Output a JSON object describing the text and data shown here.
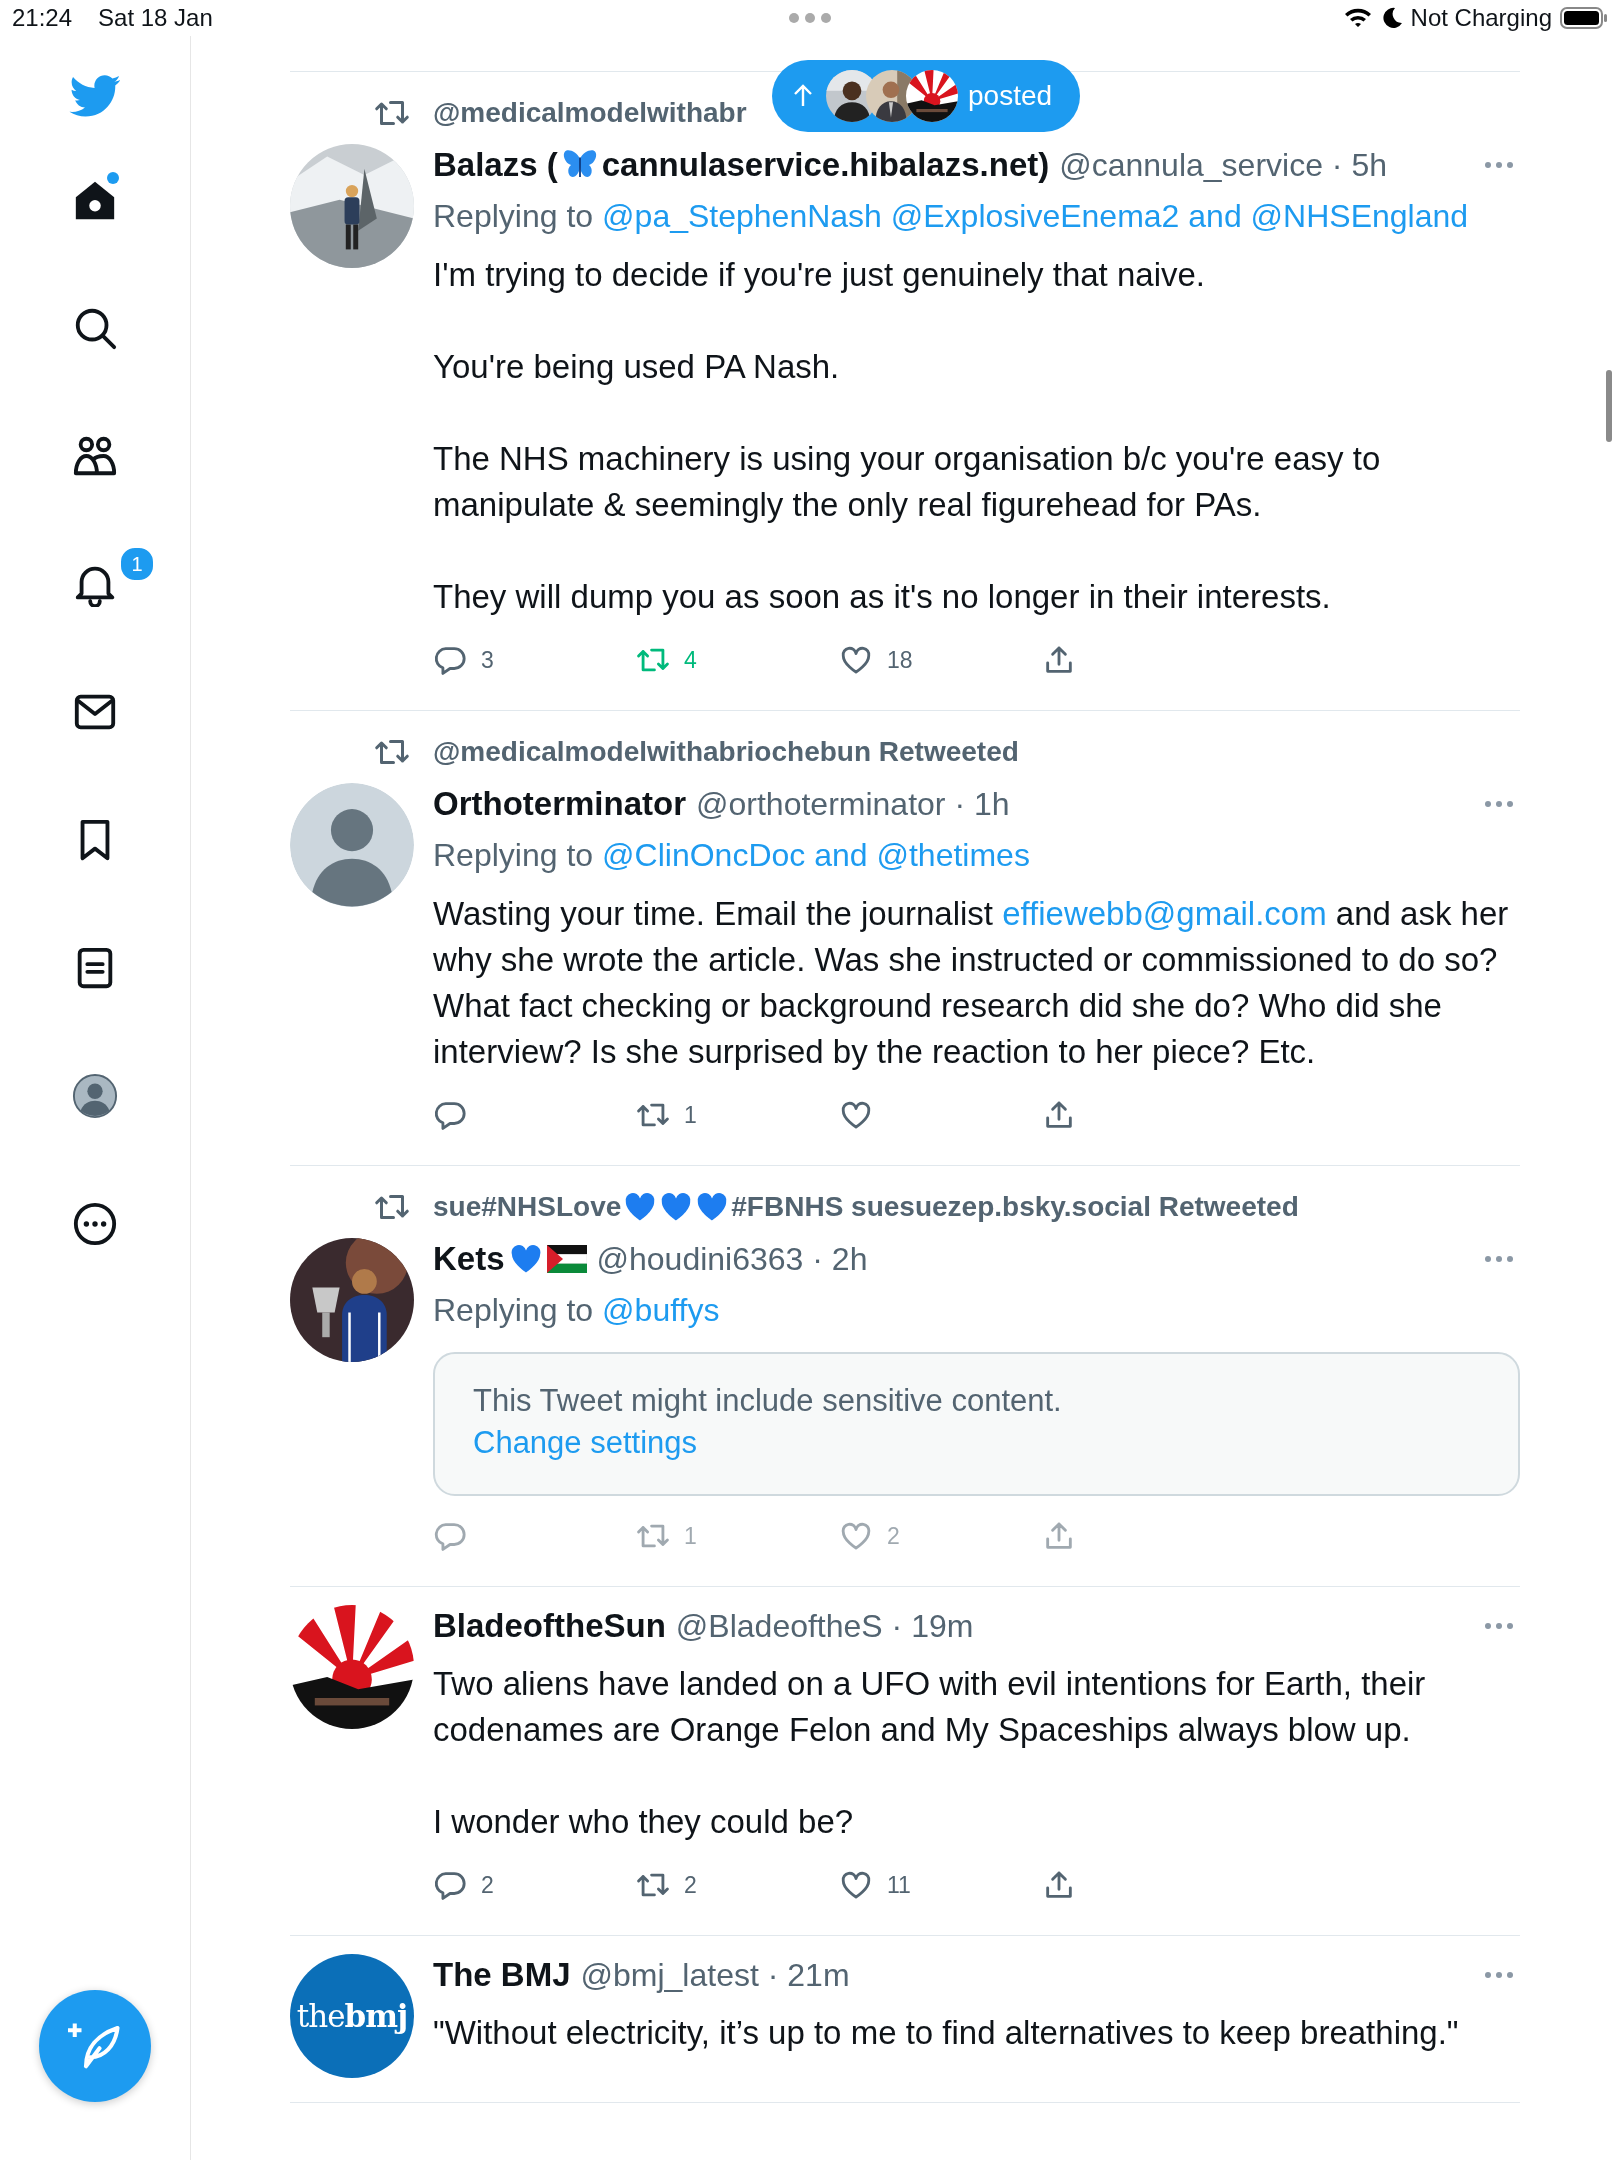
{
  "status_bar": {
    "time": "21:24",
    "date": "Sat 18 Jan",
    "charging": "Not Charging"
  },
  "sidebar": {
    "items": [
      {
        "kind": "home",
        "selected": true,
        "unread": true
      },
      {
        "kind": "search",
        "selected": false
      },
      {
        "kind": "communities",
        "selected": false
      },
      {
        "kind": "notifications",
        "selected": false,
        "badge": "1"
      },
      {
        "kind": "messages",
        "selected": false
      },
      {
        "kind": "bookmarks",
        "selected": false
      },
      {
        "kind": "lists",
        "selected": false
      },
      {
        "kind": "profile",
        "selected": false
      },
      {
        "kind": "more",
        "selected": false
      }
    ]
  },
  "new_posts_pill": {
    "label": "posted",
    "avatars": [
      {
        "kind": "picture"
      },
      {
        "kind": "picture"
      },
      {
        "kind": "picture"
      }
    ]
  },
  "tweets": [
    {
      "retweeted_by": [
        {
          "kind": "text",
          "text": "@medicalmodelwithabr"
        }
      ],
      "avatar": {
        "kind": "picture"
      },
      "name": [
        {
          "kind": "text",
          "text": "Balazs ("
        },
        {
          "kind": "butterfly"
        },
        {
          "kind": "text",
          "text": "cannulaservice.hibalazs.net)"
        }
      ],
      "meta": "@cannula_service · 5h",
      "replying_label": "Replying to",
      "replying_to": "@pa_StephenNash @ExplosiveEnema2 and @NHSEngland",
      "paragraphs": [
        [
          {
            "text": "I'm trying to decide if you're just genuinely that naive.",
            "link": false
          }
        ],
        [
          {
            "text": "You're being used PA Nash.",
            "link": false
          }
        ],
        [
          {
            "text": "The NHS machinery is using your organisation b/c you're easy to manipulate & seemingly the only real figurehead for PAs.",
            "link": false
          }
        ],
        [
          {
            "text": "They will dump you as soon as it's no longer in their interests.",
            "link": false
          }
        ]
      ],
      "actions": {
        "replies": "3",
        "retweets": "4",
        "likes": "18",
        "retweeted": true,
        "dimmed": false
      }
    },
    {
      "retweeted_by": [
        {
          "kind": "text",
          "text": "@medicalmodelwithabriochebun Retweeted"
        }
      ],
      "avatar": {
        "kind": "default"
      },
      "name": [
        {
          "kind": "text",
          "text": "Orthoterminator"
        }
      ],
      "meta": "@orthoterminator · 1h",
      "replying_label": "Replying to",
      "replying_to": "@ClinOncDoc and @thetimes",
      "paragraphs": [
        [
          {
            "text": "Wasting your time. Email the journalist ",
            "link": false
          },
          {
            "text": "effiewebb@gmail.com",
            "link": true
          },
          {
            "text": " and ask her why she wrote the article. Was she instructed or commissioned to do so? What fact checking or background research did she do? Who did she interview? Is she surprised by the reaction to her piece? Etc.",
            "link": false
          }
        ]
      ],
      "actions": {
        "retweets": "1",
        "retweeted": false,
        "dimmed": false
      }
    },
    {
      "retweeted_by": [
        {
          "kind": "text",
          "text": "sue#NHSLove"
        },
        {
          "kind": "heart"
        },
        {
          "kind": "heart"
        },
        {
          "kind": "heart"
        },
        {
          "kind": "text",
          "text": "#FBNHS suesuezep.bsky.social Retweeted"
        }
      ],
      "avatar": {
        "kind": "picture"
      },
      "name": [
        {
          "kind": "text",
          "text": "Kets"
        },
        {
          "kind": "heart"
        },
        {
          "kind": "flag"
        }
      ],
      "meta": "@houdini6363 · 2h",
      "replying_label": "Replying to",
      "replying_to": "@buffys",
      "sensitive": {
        "message": "This Tweet might include sensitive content.",
        "link": "Change settings"
      },
      "actions": {
        "retweets": "1",
        "likes": "2",
        "retweeted": false,
        "dimmed": true
      }
    },
    {
      "avatar": {
        "kind": "picture"
      },
      "name": [
        {
          "kind": "text",
          "text": "BladeoftheSun"
        }
      ],
      "meta": "@BladeoftheS · 19m",
      "paragraphs": [
        [
          {
            "text": "Two aliens have landed on a UFO with evil intentions for Earth, their codenames are Orange Felon and My Spaceships always blow up.",
            "link": false
          }
        ],
        [
          {
            "text": "I wonder who they could be?",
            "link": false
          }
        ]
      ],
      "actions": {
        "replies": "2",
        "retweets": "2",
        "likes": "11",
        "retweeted": false,
        "dimmed": false
      }
    },
    {
      "avatar": {
        "kind": "logo",
        "text": "the**bmj**"
      },
      "name": [
        {
          "kind": "text",
          "text": "The BMJ"
        }
      ],
      "meta": "@bmj_latest · 21m",
      "paragraphs": [
        [
          {
            "text": "\"Without electricity, it’s up to me to find alternatives to keep breathing.\"",
            "link": false
          }
        ]
      ]
    }
  ]
}
